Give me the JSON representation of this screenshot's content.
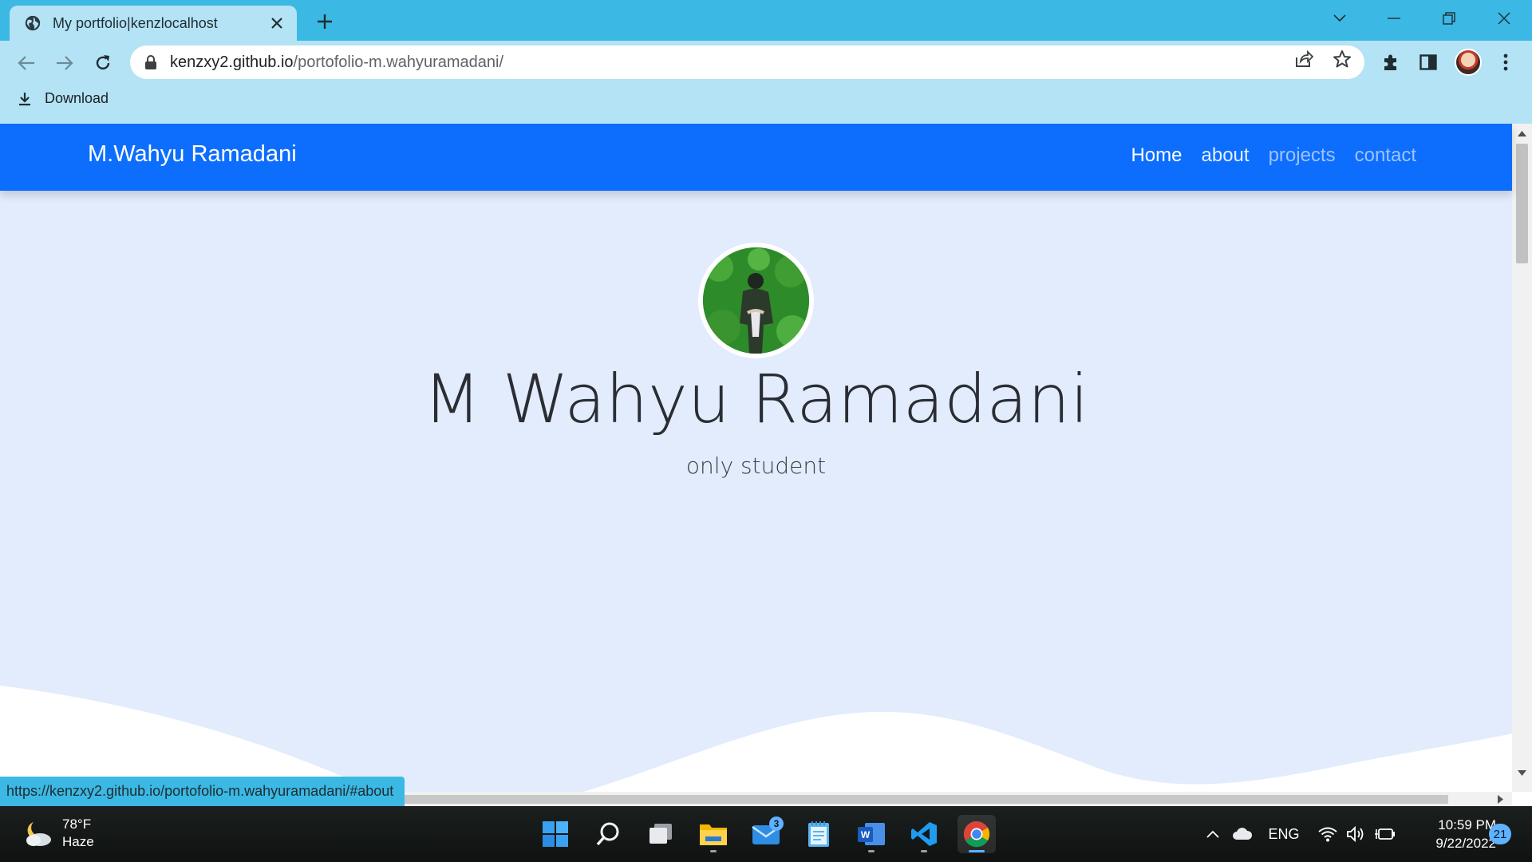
{
  "browser": {
    "tab_title": "My portfolio|kenzlocalhost",
    "url_host": "kenzxy2.github.io",
    "url_path": "/portofolio-m.wahyuramadani/",
    "bookmark_label": "Download",
    "status_url": "https://kenzxy2.github.io/portofolio-m.wahyuramadani/#about"
  },
  "site": {
    "brand": "M.Wahyu Ramadani",
    "nav": [
      "Home",
      "about",
      "projects",
      "contact"
    ],
    "hero_title": "M Wahyu Ramadani",
    "hero_subtitle": "only student"
  },
  "colors": {
    "navbar": "#0d6efd",
    "hero_bg": "#e2ecfd",
    "chrome_tabbar": "#3bb8e3",
    "chrome_toolbar": "#b3e3f5"
  },
  "taskbar": {
    "weather_temp": "78°F",
    "weather_desc": "Haze",
    "mail_badge": "3",
    "language": "ENG",
    "time": "10:59 PM",
    "date": "9/22/2022",
    "notification_count": "21"
  }
}
